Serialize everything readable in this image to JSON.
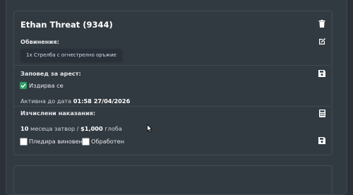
{
  "person": {
    "name": "Ethan Threat (9344)"
  },
  "charges": {
    "label": "Обвинения:",
    "items": [
      "1x Стрелба с огнестрелно оръжие"
    ]
  },
  "warrant": {
    "label": "Заповед за арест:",
    "checkbox_label": "Издирва се",
    "checked": true,
    "active_prefix": "Активна до дата",
    "active_until": "01:58 27/04/2026"
  },
  "penalties": {
    "label": "Изчислени наказания:",
    "months": "10",
    "months_text": "месеца затвор /",
    "fine": "$1,000",
    "fine_text": "глоба"
  },
  "footer": {
    "plead_guilty_label": "Пледира виновен",
    "processed_label": "Обработен"
  },
  "icons": {
    "delete": "trash-icon",
    "edit": "edit-icon",
    "save": "save-icon",
    "calc": "calculator-icon"
  },
  "colors": {
    "background": "#2b3137",
    "card": "#323a41",
    "check_green": "#2f9f63"
  }
}
